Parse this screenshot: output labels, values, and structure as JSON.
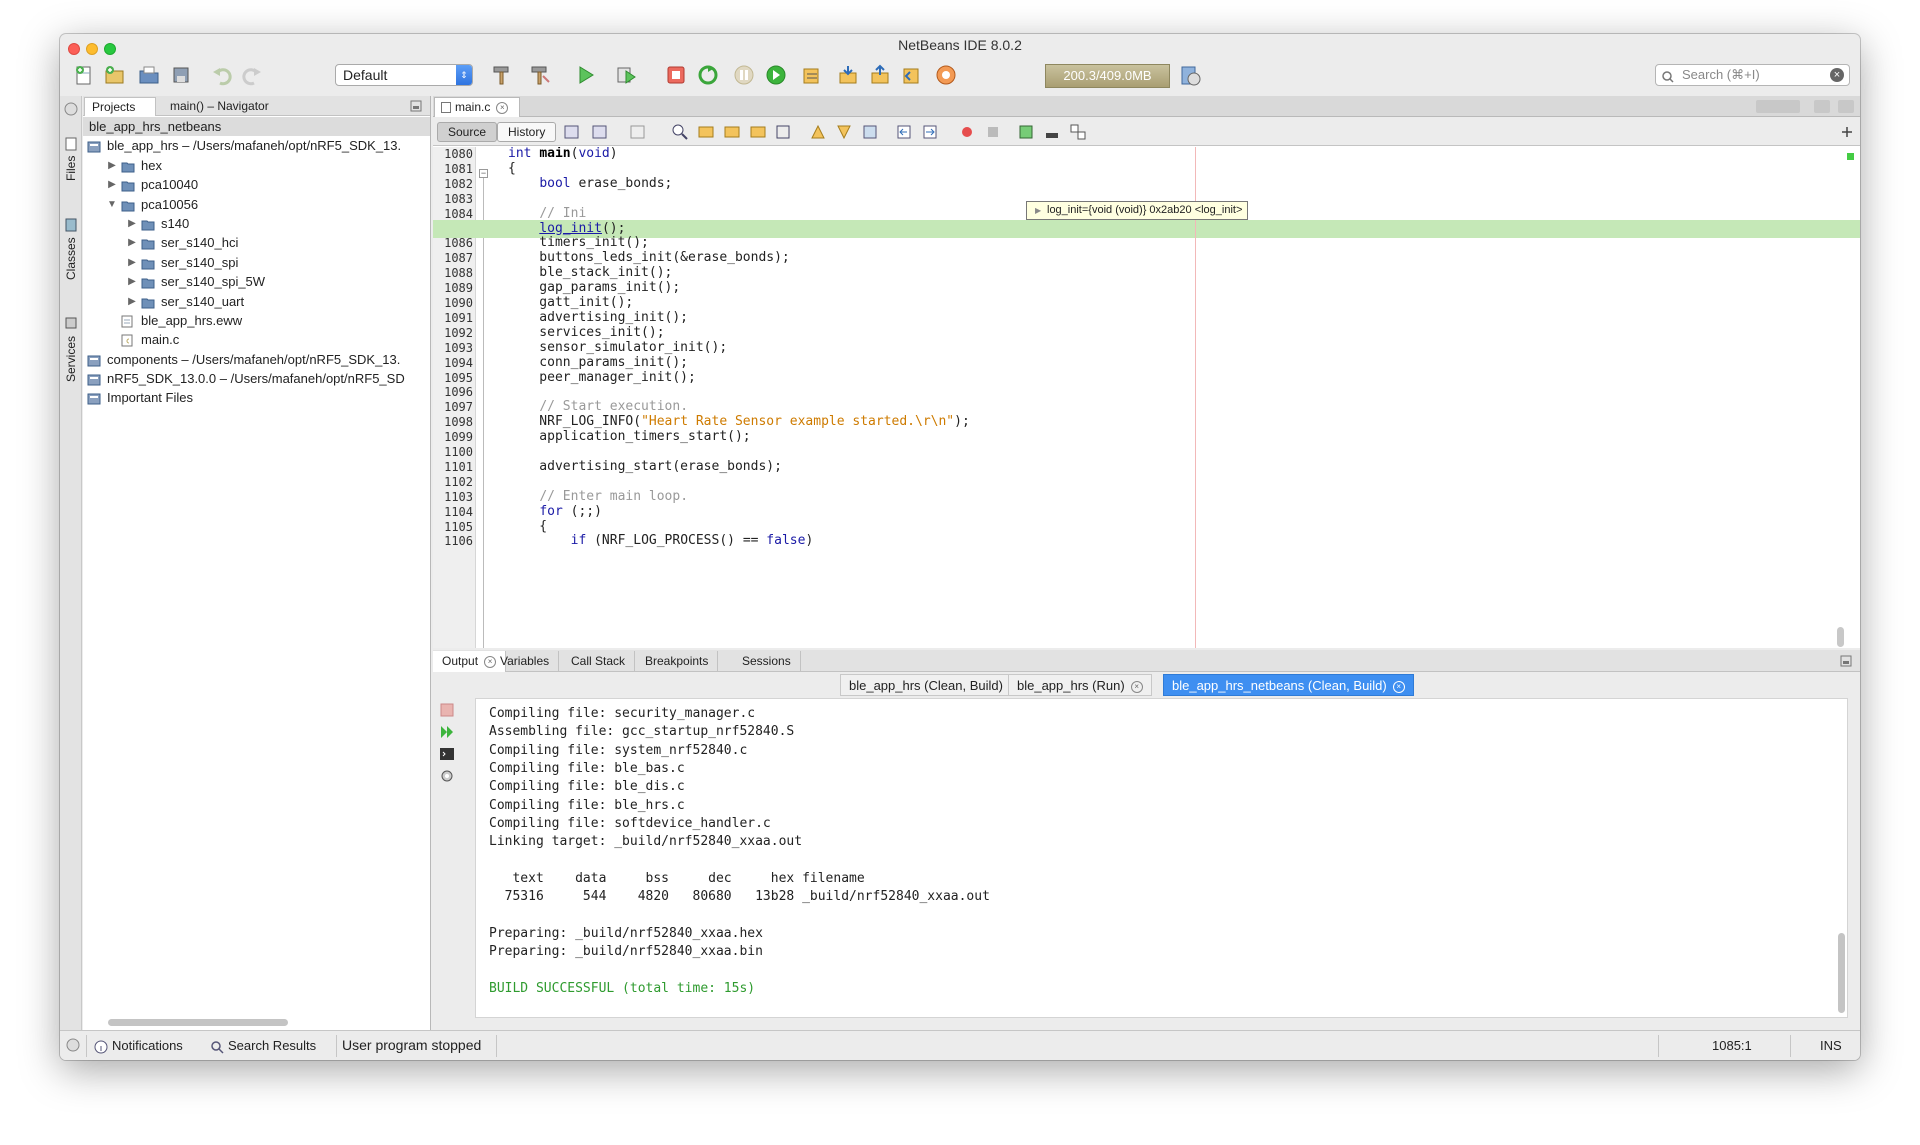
{
  "window": {
    "title": "NetBeans IDE 8.0.2"
  },
  "toolbar": {
    "config_value": "Default",
    "memory": "200.3/409.0MB",
    "search_placeholder": "Search (⌘+I)"
  },
  "side_strip": {
    "tabs": [
      "Files",
      "Classes",
      "Services"
    ]
  },
  "projects": {
    "tabs": [
      "Projects",
      "main() – Navigator"
    ],
    "tree": [
      {
        "label": "ble_app_hrs_netbeans",
        "level": 0,
        "toggle": "",
        "icon": "none",
        "selected": true
      },
      {
        "label": "ble_app_hrs – /Users/mafaneh/opt/nRF5_SDK_13.",
        "level": 0,
        "toggle": "",
        "icon": "project"
      },
      {
        "label": "hex",
        "level": 1,
        "toggle": "▶",
        "icon": "folder"
      },
      {
        "label": "pca10040",
        "level": 1,
        "toggle": "▶",
        "icon": "folder"
      },
      {
        "label": "pca10056",
        "level": 1,
        "toggle": "▼",
        "icon": "folder"
      },
      {
        "label": "s140",
        "level": 2,
        "toggle": "▶",
        "icon": "folder"
      },
      {
        "label": "ser_s140_hci",
        "level": 2,
        "toggle": "▶",
        "icon": "folder"
      },
      {
        "label": "ser_s140_spi",
        "level": 2,
        "toggle": "▶",
        "icon": "folder"
      },
      {
        "label": "ser_s140_spi_5W",
        "level": 2,
        "toggle": "▶",
        "icon": "folder"
      },
      {
        "label": "ser_s140_uart",
        "level": 2,
        "toggle": "▶",
        "icon": "folder"
      },
      {
        "label": "ble_app_hrs.eww",
        "level": 1,
        "toggle": "",
        "icon": "file"
      },
      {
        "label": "main.c",
        "level": 1,
        "toggle": "",
        "icon": "cfile"
      },
      {
        "label": "components – /Users/mafaneh/opt/nRF5_SDK_13.",
        "level": 0,
        "toggle": "",
        "icon": "project"
      },
      {
        "label": "nRF5_SDK_13.0.0 – /Users/mafaneh/opt/nRF5_SD",
        "level": 0,
        "toggle": "",
        "icon": "project"
      },
      {
        "label": "Important Files",
        "level": 0,
        "toggle": "",
        "icon": "project"
      }
    ]
  },
  "editor": {
    "tab": "main.c",
    "source_label": "Source",
    "history_label": "History",
    "tooltip": "log_init={void (void)} 0x2ab20 <log_init>",
    "lines": [
      {
        "n": "1080",
        "t": "int main(void)"
      },
      {
        "n": "1081",
        "t": "{"
      },
      {
        "n": "1082",
        "t": "    bool erase_bonds;"
      },
      {
        "n": "1083",
        "t": ""
      },
      {
        "n": "1084",
        "t": "    // Ini"
      },
      {
        "n": "",
        "t": "    log_init();"
      },
      {
        "n": "1086",
        "t": "    timers_init();"
      },
      {
        "n": "1087",
        "t": "    buttons_leds_init(&erase_bonds);"
      },
      {
        "n": "1088",
        "t": "    ble_stack_init();"
      },
      {
        "n": "1089",
        "t": "    gap_params_init();"
      },
      {
        "n": "1090",
        "t": "    gatt_init();"
      },
      {
        "n": "1091",
        "t": "    advertising_init();"
      },
      {
        "n": "1092",
        "t": "    services_init();"
      },
      {
        "n": "1093",
        "t": "    sensor_simulator_init();"
      },
      {
        "n": "1094",
        "t": "    conn_params_init();"
      },
      {
        "n": "1095",
        "t": "    peer_manager_init();"
      },
      {
        "n": "1096",
        "t": ""
      },
      {
        "n": "1097",
        "t": "    // Start execution."
      },
      {
        "n": "1098",
        "t": "    NRF_LOG_INFO(\"Heart Rate Sensor example started.\\r\\n\");"
      },
      {
        "n": "1099",
        "t": "    application_timers_start();"
      },
      {
        "n": "1100",
        "t": ""
      },
      {
        "n": "1101",
        "t": "    advertising_start(erase_bonds);"
      },
      {
        "n": "1102",
        "t": ""
      },
      {
        "n": "1103",
        "t": "    // Enter main loop."
      },
      {
        "n": "1104",
        "t": "    for (;;)"
      },
      {
        "n": "1105",
        "t": "    {"
      },
      {
        "n": "1106",
        "t": "        if (NRF_LOG_PROCESS() == false)"
      }
    ]
  },
  "output": {
    "tabs": [
      "Output",
      "Variables",
      "Call Stack",
      "Breakpoints",
      "Sessions"
    ],
    "subtabs": [
      "ble_app_hrs (Clean, Build)",
      "ble_app_hrs (Run)",
      "ble_app_hrs_netbeans (Clean, Build)"
    ],
    "lines": [
      "Compiling file: security_manager.c",
      "Assembling file: gcc_startup_nrf52840.S",
      "Compiling file: system_nrf52840.c",
      "Compiling file: ble_bas.c",
      "Compiling file: ble_dis.c",
      "Compiling file: ble_hrs.c",
      "Compiling file: softdevice_handler.c",
      "Linking target: _build/nrf52840_xxaa.out",
      "",
      "   text    data     bss     dec     hex filename",
      "  75316     544    4820   80680   13b28 _build/nrf52840_xxaa.out",
      "",
      "Preparing: _build/nrf52840_xxaa.hex",
      "Preparing: _build/nrf52840_xxaa.bin",
      "",
      "BUILD SUCCESSFUL (total time: 15s)"
    ]
  },
  "status": {
    "notifications": "Notifications",
    "search_results": "Search Results",
    "message": "User program stopped",
    "position": "1085:1",
    "mode": "INS"
  }
}
